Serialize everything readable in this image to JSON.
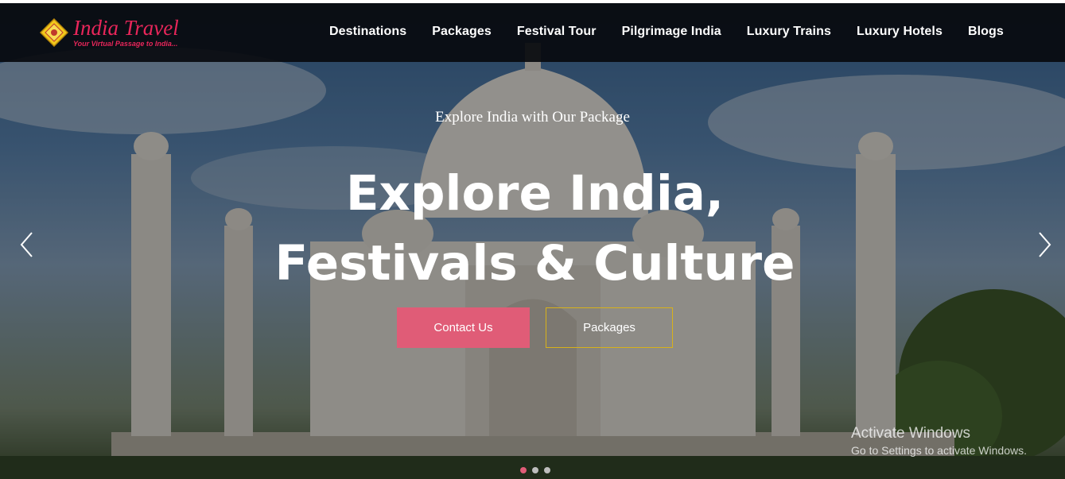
{
  "brand": {
    "title": "India Travel",
    "tagline": "Your Virtual Passage to India..."
  },
  "nav": {
    "items": [
      {
        "label": "Destinations"
      },
      {
        "label": "Packages"
      },
      {
        "label": "Festival Tour"
      },
      {
        "label": "Pilgrimage India"
      },
      {
        "label": "Luxury Trains"
      },
      {
        "label": "Luxury Hotels"
      },
      {
        "label": "Blogs"
      }
    ]
  },
  "hero": {
    "kicker": "Explore India with Our Package",
    "headline_line1": "Explore India,",
    "headline_line2": "Festivals & Culture",
    "contact_label": "Contact Us",
    "packages_label": "Packages",
    "slides_total": 3,
    "active_slide": 1
  },
  "watermark": {
    "title": "Activate Windows",
    "subtitle": "Go to Settings to activate Windows."
  },
  "colors": {
    "accent_pink": "#e05c77",
    "brand_pink": "#e8265a",
    "outline_gold": "#d8b21a",
    "nav_bg": "#080a0e"
  },
  "icons": {
    "prev": "chevron-left-icon",
    "next": "chevron-right-icon",
    "logo": "diamond-logo-icon"
  }
}
